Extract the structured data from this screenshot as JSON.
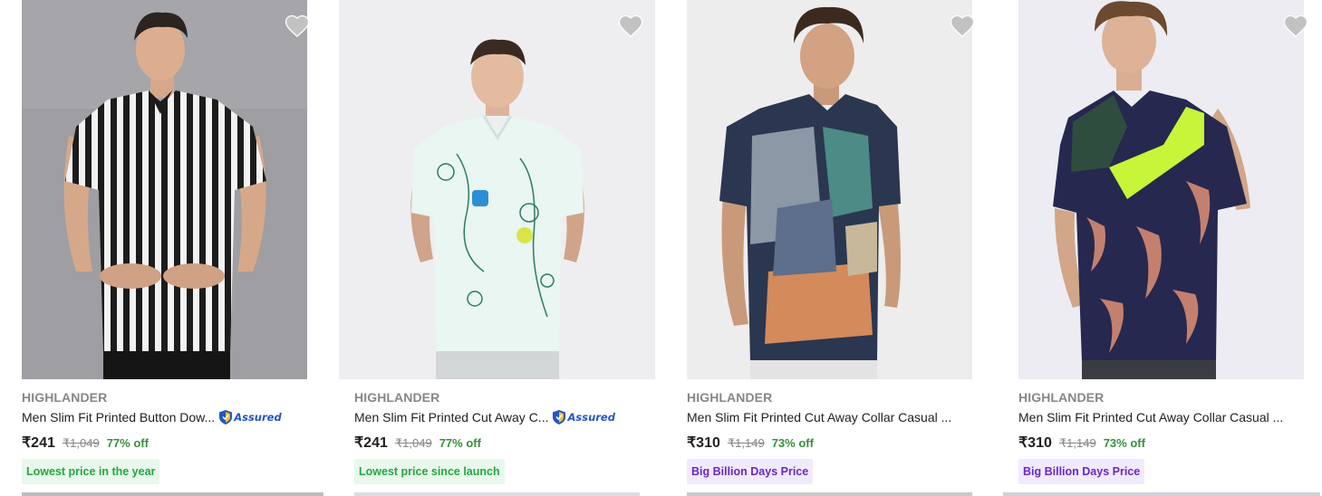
{
  "products": [
    {
      "brand": "HIGHLANDER",
      "title": "Men Slim Fit Printed Button Dow...",
      "assured": true,
      "assured_label": "Assured",
      "price": "₹241",
      "mrp": "₹1,049",
      "discount": "77% off",
      "badge": "Lowest price in the year",
      "badge_style": "green",
      "image_icon": "striped-shirt-model-image",
      "wishlist_icon": "heart-icon"
    },
    {
      "brand": "HIGHLANDER",
      "title": "Men Slim Fit Printed Cut Away C...",
      "assured": true,
      "assured_label": "Assured",
      "price": "₹241",
      "mrp": "₹1,049",
      "discount": "77% off",
      "badge": "Lowest price since launch",
      "badge_style": "green",
      "image_icon": "floral-shirt-model-image",
      "wishlist_icon": "heart-icon"
    },
    {
      "brand": "HIGHLANDER",
      "title": "Men Slim Fit Printed Cut Away Collar Casual ...",
      "assured": false,
      "price": "₹310",
      "mrp": "₹1,149",
      "discount": "73% off",
      "badge": "Big Billion Days Price",
      "badge_style": "purple",
      "image_icon": "abstract-print-shirt-model-image",
      "wishlist_icon": "heart-icon"
    },
    {
      "brand": "HIGHLANDER",
      "title": "Men Slim Fit Printed Cut Away Collar Casual ...",
      "assured": false,
      "price": "₹310",
      "mrp": "₹1,149",
      "discount": "73% off",
      "badge": "Big Billion Days Price",
      "badge_style": "purple",
      "image_icon": "neon-panel-shirt-model-image",
      "wishlist_icon": "heart-icon"
    }
  ],
  "colors": {
    "discount_green": "#388e3c",
    "badge_green_text": "#26a541",
    "badge_green_bg": "#e8f8ec",
    "badge_purple_text": "#6a27c7",
    "badge_purple_bg": "#f1eafc",
    "assured_blue": "#2455c6",
    "wishlist_grey": "#c2c2c2"
  }
}
